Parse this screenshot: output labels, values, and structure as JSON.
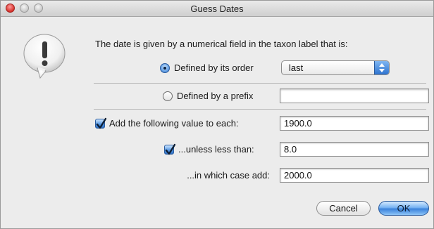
{
  "window": {
    "title": "Guess Dates"
  },
  "dialog": {
    "prompt": "The date is given by a numerical field in the taxon label that is:",
    "order_option_label": "Defined by its order",
    "order_selected": true,
    "order_popup_value": "last",
    "prefix_option_label": "Defined by a prefix",
    "prefix_selected": false,
    "prefix_value": "",
    "add_value_label": "Add the following value to each:",
    "add_value_checked": true,
    "add_value": "1900.0",
    "unless_label": "...unless less than:",
    "unless_checked": true,
    "unless_value": "8.0",
    "in_which_case_label": "...in which case add:",
    "in_which_case_value": "2000.0"
  },
  "buttons": {
    "cancel": "Cancel",
    "ok": "OK"
  },
  "colors": {
    "accent_blue": "#3a82db",
    "window_bg": "#ececec"
  },
  "icons": {
    "alert": "exclamation-alert-icon"
  }
}
